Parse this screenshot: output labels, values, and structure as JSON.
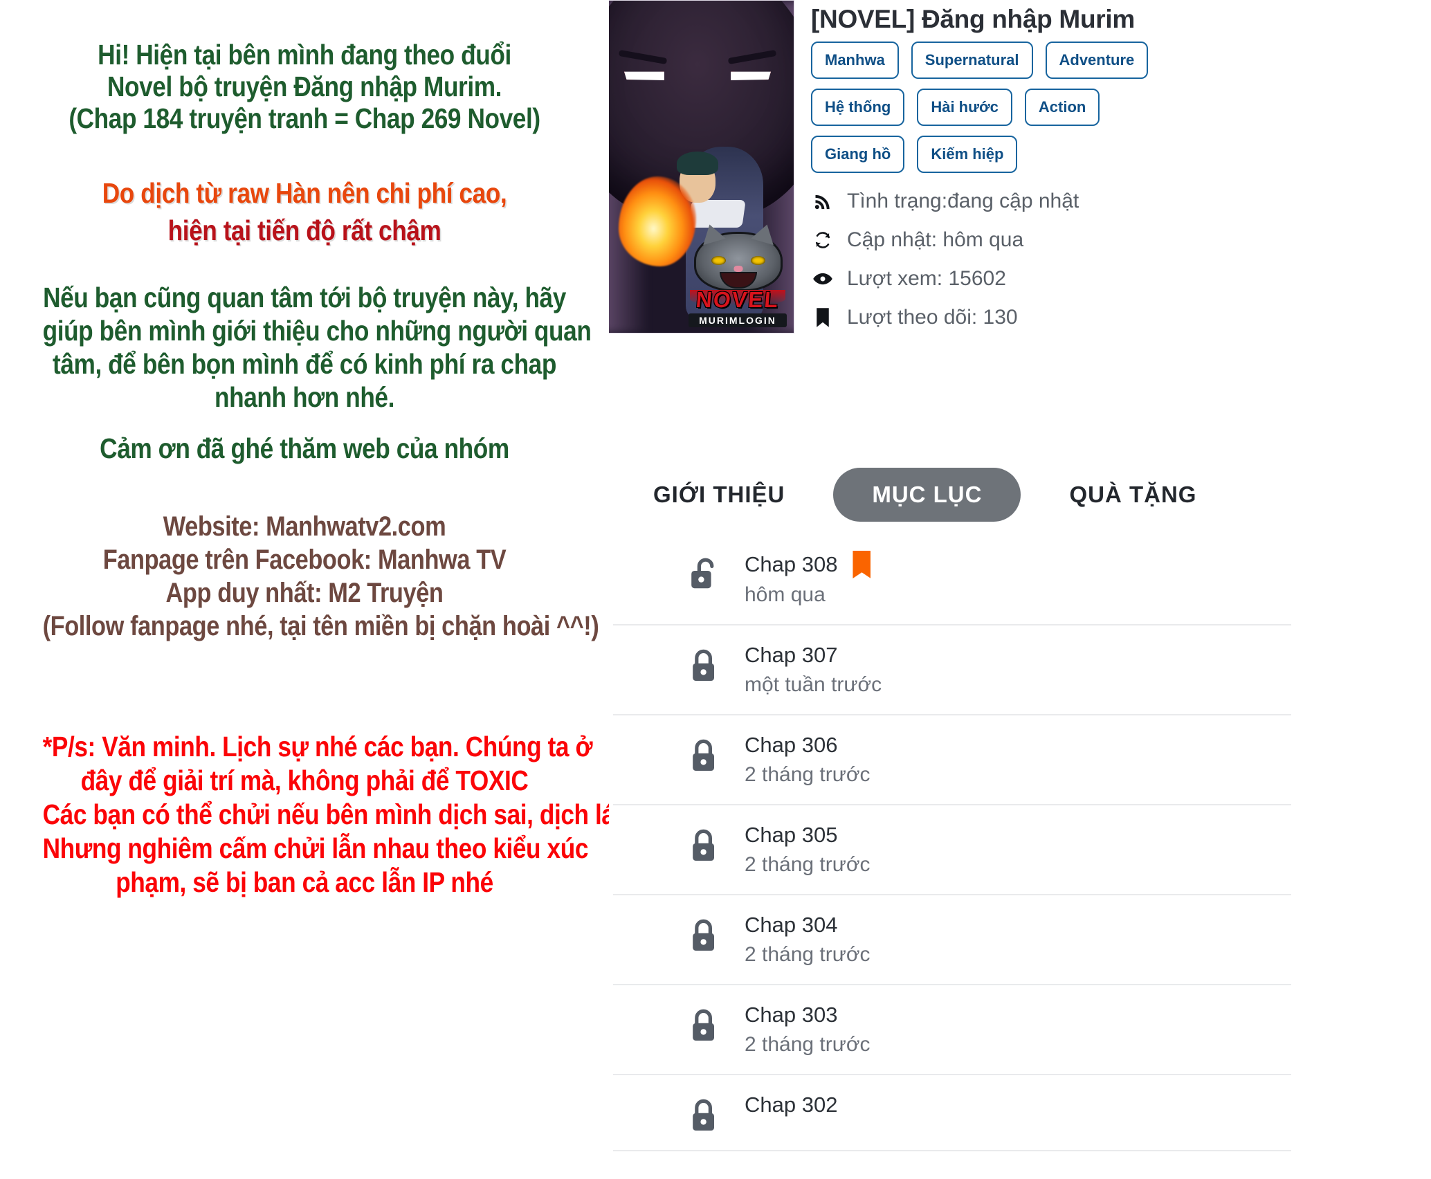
{
  "notice": {
    "group1": {
      "color": "#1e5c2e",
      "lines": [
        "Hi! Hiện tại bên mình đang theo đuổi",
        "Novel bộ truyện Đăng nhập Murim.",
        "(Chap 184 truyện tranh = Chap 269 Novel)"
      ]
    },
    "group2": {
      "color_line1": "#e8470d",
      "color_line2": "#b8121a",
      "line1": "Do dịch từ raw Hàn nên chi phí cao,",
      "line2": "hiện tại tiến độ rất chậm"
    },
    "group3": {
      "color": "#1e5c2e",
      "lines": [
        "Nếu bạn cũng quan tâm tới bộ truyện này, hãy",
        "giúp bên mình giới thiệu cho những người quan",
        "tâm, để bên bọn mình để có kinh phí ra chap",
        "nhanh hơn nhé."
      ]
    },
    "group4": {
      "color": "#1e5c2e",
      "lines": [
        "Cảm ơn đã ghé thăm web của nhóm"
      ]
    },
    "group5": {
      "color": "#6d4840",
      "lines": [
        "Website: Manhwatv2.com",
        "Fanpage trên Facebook: Manhwa TV",
        "App duy nhất: M2 Truyện",
        "(Follow fanpage nhé, tại tên miền bị chặn hoài ^^!)"
      ]
    },
    "group6": {
      "color": "#fb0407",
      "lines": [
        "*P/s: Văn minh. Lịch sự nhé các bạn. Chúng ta ở",
        "đây để giải trí mà, không phải để TOXIC",
        "Các bạn có thể chửi nếu bên mình dịch sai, dịch láo.",
        "Nhưng nghiêm cấm chửi lẫn nhau theo kiểu xúc",
        "phạm, sẽ bị ban cả acc lẫn IP nhé"
      ]
    }
  },
  "comic": {
    "title": "[NOVEL] Đăng nhập Murim",
    "cover_alt": "novel-murim-login-cover",
    "cover_logo_main": "NOVEL",
    "cover_logo_sub": "MURIMLOGIN",
    "tags": [
      "Manhwa",
      "Supernatural",
      "Adventure",
      "Hệ thống",
      "Hài hước",
      "Action",
      "Giang hồ",
      "Kiếm hiệp"
    ],
    "tag_color": "#0f4f86",
    "meta": [
      {
        "icon": "rss-icon",
        "text": "Tình trạng:đang cập nhật"
      },
      {
        "icon": "sync-icon",
        "text": "Cập nhật: hôm qua"
      },
      {
        "icon": "eye-icon",
        "text": "Lượt xem: 15602"
      },
      {
        "icon": "bookmark-icon",
        "text": "Lượt theo dõi: 130"
      }
    ]
  },
  "tabs": {
    "items": [
      {
        "label": "GIỚI THIỆU",
        "active": false
      },
      {
        "label": "MỤC LỤC",
        "active": true
      },
      {
        "label": "QUÀ TẶNG",
        "active": false
      }
    ],
    "active_bg": "#6e7379"
  },
  "chapters": {
    "bookmark_color": "#fa6400",
    "items": [
      {
        "name": "Chap 308",
        "time": "hôm qua",
        "locked": false,
        "bookmarked": true
      },
      {
        "name": "Chap 307",
        "time": "một tuần trước",
        "locked": true,
        "bookmarked": false
      },
      {
        "name": "Chap 306",
        "time": "2 tháng trước",
        "locked": true,
        "bookmarked": false
      },
      {
        "name": "Chap 305",
        "time": "2 tháng trước",
        "locked": true,
        "bookmarked": false
      },
      {
        "name": "Chap 304",
        "time": "2 tháng trước",
        "locked": true,
        "bookmarked": false
      },
      {
        "name": "Chap 303",
        "time": "2 tháng trước",
        "locked": true,
        "bookmarked": false
      },
      {
        "name": "Chap 302",
        "time": "",
        "locked": true,
        "bookmarked": false
      }
    ]
  }
}
